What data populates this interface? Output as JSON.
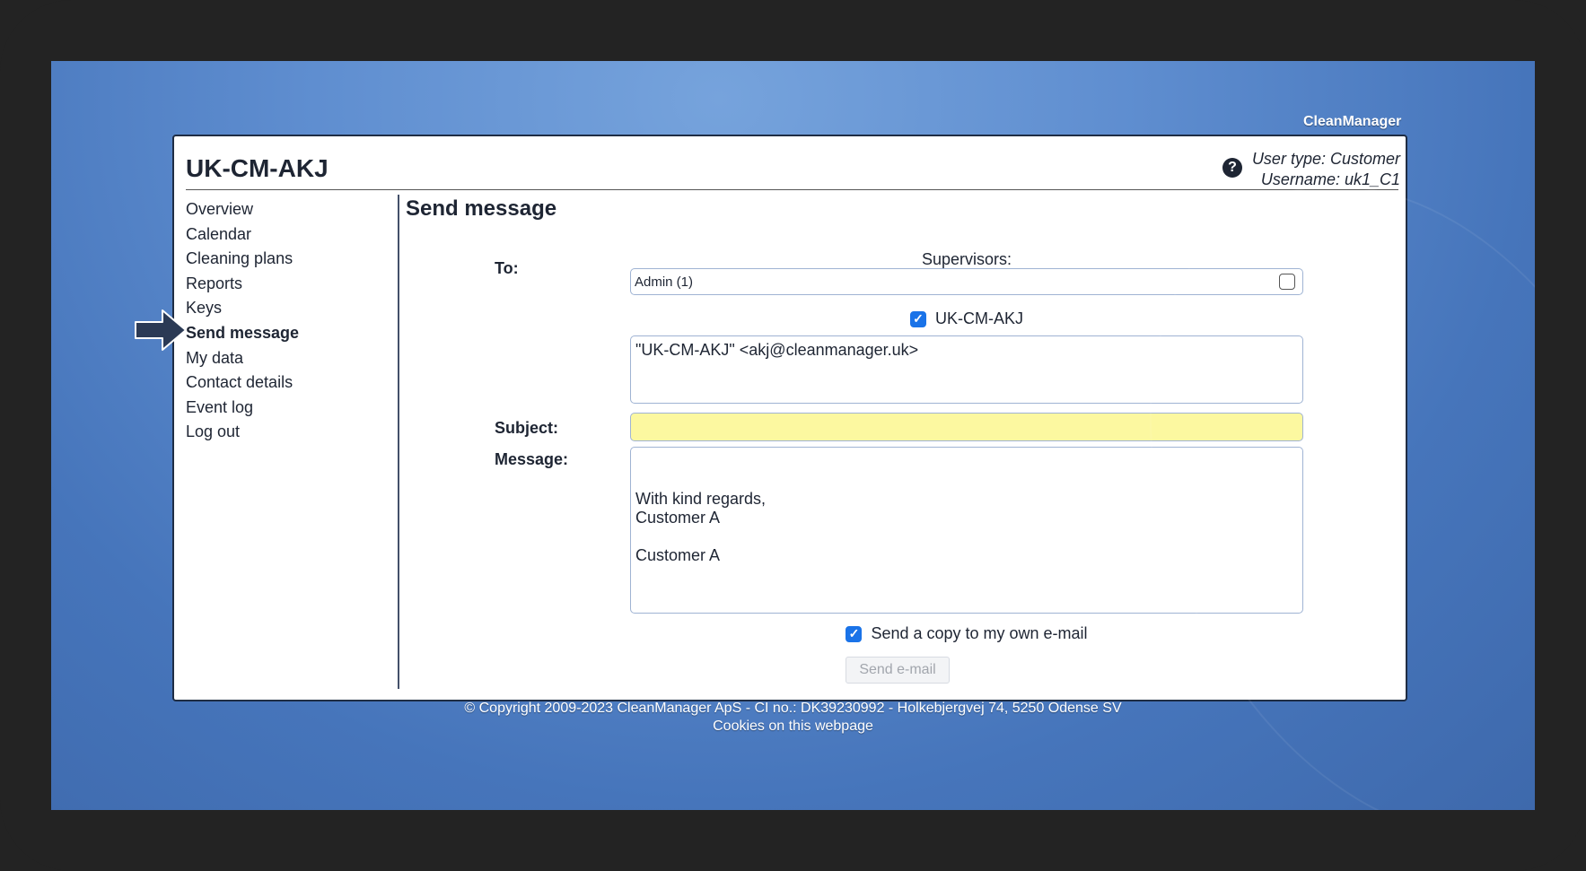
{
  "brand": "CleanManager",
  "site_title": "UK-CM-AKJ",
  "user": {
    "type_line": "User type: Customer",
    "username_line": "Username: uk1_C1"
  },
  "nav": {
    "items": [
      {
        "label": "Overview"
      },
      {
        "label": "Calendar"
      },
      {
        "label": "Cleaning plans"
      },
      {
        "label": "Reports"
      },
      {
        "label": "Keys"
      },
      {
        "label": "Send message",
        "active": true
      },
      {
        "label": "My data"
      },
      {
        "label": "Contact details"
      },
      {
        "label": "Event log"
      },
      {
        "label": "Log out"
      }
    ]
  },
  "form": {
    "heading": "Send message",
    "to_label": "To:",
    "supervisors_label": "Supervisors:",
    "supervisor_option": "Admin (1)",
    "supervisor_checked": false,
    "self_label": "UK-CM-AKJ",
    "self_checked": true,
    "recipients_text": "\"UK-CM-AKJ\" <akj@cleanmanager.uk>",
    "subject_label": "Subject:",
    "subject_value": "",
    "message_label": "Message:",
    "message_text": "\n\nWith kind regards,\nCustomer A\n\nCustomer A",
    "copy_label": "Send a copy to my own e-mail",
    "copy_checked": true,
    "send_button": "Send e-mail"
  },
  "footer": {
    "copyright": "© Copyright 2009-2023 CleanManager ApS - CI no.: DK39230992 - Holkebjergvej 74, 5250 Odense SV",
    "cookies_link": "Cookies on this webpage"
  },
  "colors": {
    "subject_highlight": "#fcf8a0",
    "checkbox_accent": "#1a73e8",
    "arrow": "#2b3a55"
  }
}
